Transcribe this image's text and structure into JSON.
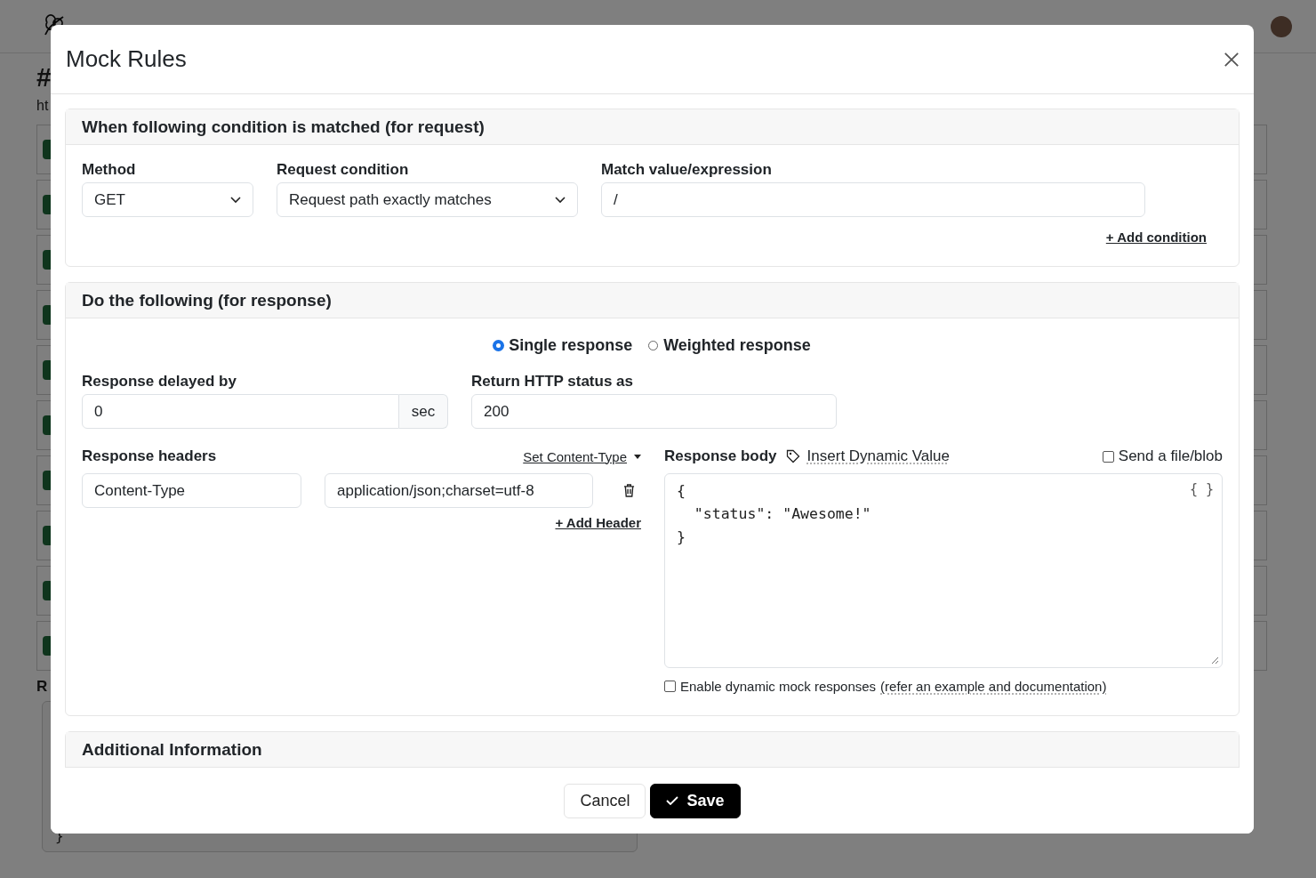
{
  "background": {
    "heading": "#",
    "url": "ht",
    "section_label": "R",
    "code_end": "}"
  },
  "modal": {
    "title": "Mock Rules",
    "request": {
      "title": "When following condition is matched (for request)",
      "method_label": "Method",
      "method": "GET",
      "condition_label": "Request condition",
      "condition": "Request path exactly matches",
      "match_label": "Match value/expression",
      "match_value": "/",
      "add_condition": "+ Add condition"
    },
    "response": {
      "title": "Do the following (for response)",
      "modes": [
        {
          "label": "Single response",
          "selected": true
        },
        {
          "label": "Weighted response",
          "selected": false
        }
      ],
      "delay_label": "Response delayed by",
      "delay": "0",
      "delay_unit": "sec",
      "status_label": "Return HTTP status as",
      "status": "200",
      "headers_label": "Response headers",
      "set_content_type": "Set Content-Type",
      "headers": [
        {
          "name": "Content-Type",
          "value": "application/json;charset=utf-8"
        }
      ],
      "add_header": "+ Add Header",
      "body_label": "Response body",
      "insert_dynamic": "Insert Dynamic Value",
      "send_file": {
        "label": "Send a file/blob",
        "checked": false
      },
      "format_button": "{ }",
      "body": "{\n  \"status\": \"Awesome!\"\n}",
      "dynamic": {
        "label": "Enable dynamic mock responses",
        "checked": false
      },
      "dynamic_link": "(refer an example and documentation)"
    },
    "additional_title": "Additional Information",
    "cancel": "Cancel",
    "save": "Save"
  }
}
